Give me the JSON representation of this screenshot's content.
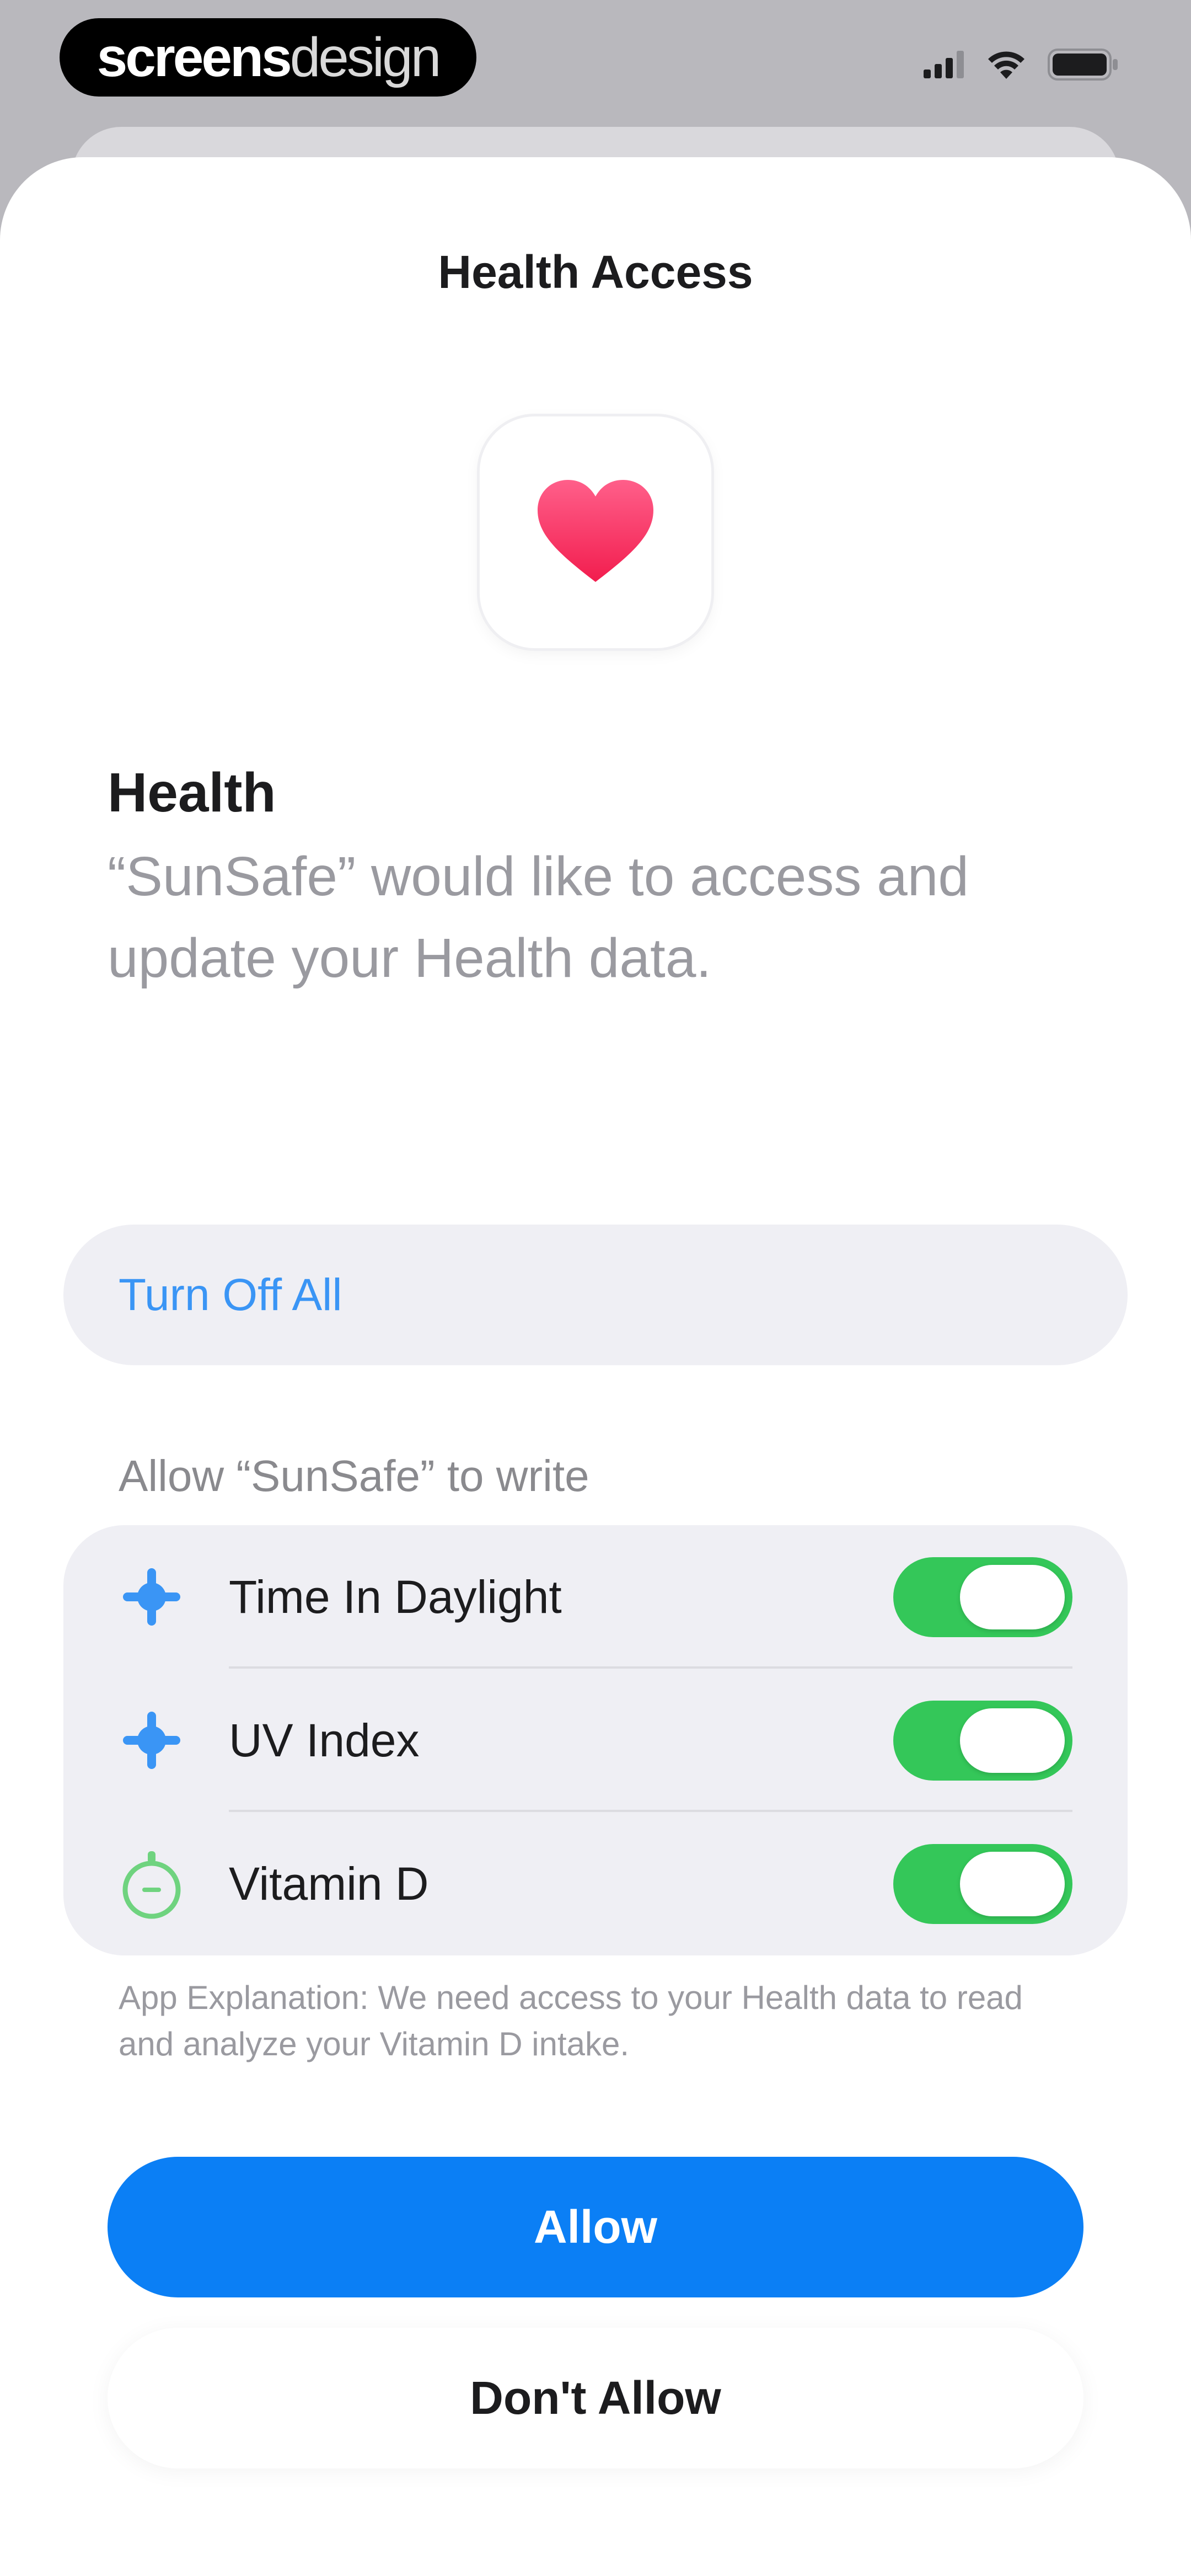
{
  "status_bar": {
    "watermark_strong": "screens",
    "watermark_light": "design",
    "icons": [
      "signal-icon",
      "wifi-icon",
      "battery-icon"
    ]
  },
  "sheet": {
    "title": "Health Access",
    "app_icon": "heart-icon",
    "heading": "Health",
    "description": "“SunSafe” would like to access and update your Health data.",
    "turn_off_all_label": "Turn Off All",
    "group_caption": "Allow “SunSafe” to write",
    "permissions": [
      {
        "label": "Time In Daylight",
        "icon": "sun-icon",
        "enabled": true
      },
      {
        "label": "UV Index",
        "icon": "sun-icon",
        "enabled": true
      },
      {
        "label": "Vitamin D",
        "icon": "vitamin-icon",
        "enabled": true
      }
    ],
    "explanation": "App Explanation: We need access to your Health data to read and analyze your Vitamin D intake.",
    "allow_label": "Allow",
    "dont_allow_label": "Don't Allow"
  },
  "colors": {
    "accent_blue": "#0b7ff5",
    "link_blue": "#3a95f5",
    "toggle_green": "#34c759",
    "heart_pink": "#ff2d55"
  }
}
